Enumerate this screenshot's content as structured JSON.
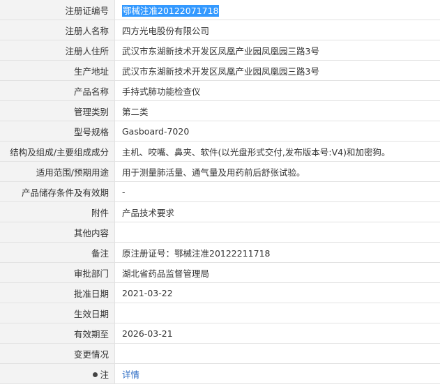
{
  "fields": {
    "reg_no": {
      "label": "注册证编号",
      "value": "鄂械注准20122071718"
    },
    "registrant": {
      "label": "注册人名称",
      "value": "四方光电股份有限公司"
    },
    "residence": {
      "label": "注册人住所",
      "value": "武汉市东湖新技术开发区凤凰产业园凤凰园三路3号"
    },
    "production": {
      "label": "生产地址",
      "value": "武汉市东湖新技术开发区凤凰产业园凤凰园三路3号"
    },
    "product_name": {
      "label": "产品名称",
      "value": "手持式肺功能检查仪"
    },
    "category": {
      "label": "管理类别",
      "value": "第二类"
    },
    "model": {
      "label": "型号规格",
      "value": "Gasboard-7020"
    },
    "structure": {
      "label": "结构及组成/主要组成成分",
      "value": "主机、咬嘴、鼻夹、软件(以光盘形式交付,发布版本号:V4)和加密狗。"
    },
    "scope": {
      "label": "适用范围/预期用途",
      "value": "用于测量肺活量、通气量及用药前后舒张试验。"
    },
    "storage": {
      "label": "产品储存条件及有效期",
      "value": "-"
    },
    "attachment": {
      "label": "附件",
      "value": "产品技术要求"
    },
    "other": {
      "label": "其他内容",
      "value": ""
    },
    "remarks": {
      "label": "备注",
      "value": "原注册证号：鄂械注准20122211718"
    },
    "approver": {
      "label": "审批部门",
      "value": "湖北省药品监督管理局"
    },
    "approval_date": {
      "label": "批准日期",
      "value": "2021-03-22"
    },
    "effective_date": {
      "label": "生效日期",
      "value": ""
    },
    "expiry_date": {
      "label": "有效期至",
      "value": "2026-03-21"
    },
    "changes": {
      "label": "变更情况",
      "value": ""
    },
    "note": {
      "label": "注",
      "link_text": "详情",
      "icon": "note-bullet-icon"
    }
  },
  "colors": {
    "label_bg": "#f3f3f3",
    "border": "#e2e2e2",
    "selection_bg": "#3399ff",
    "link": "#2a6ac3"
  }
}
